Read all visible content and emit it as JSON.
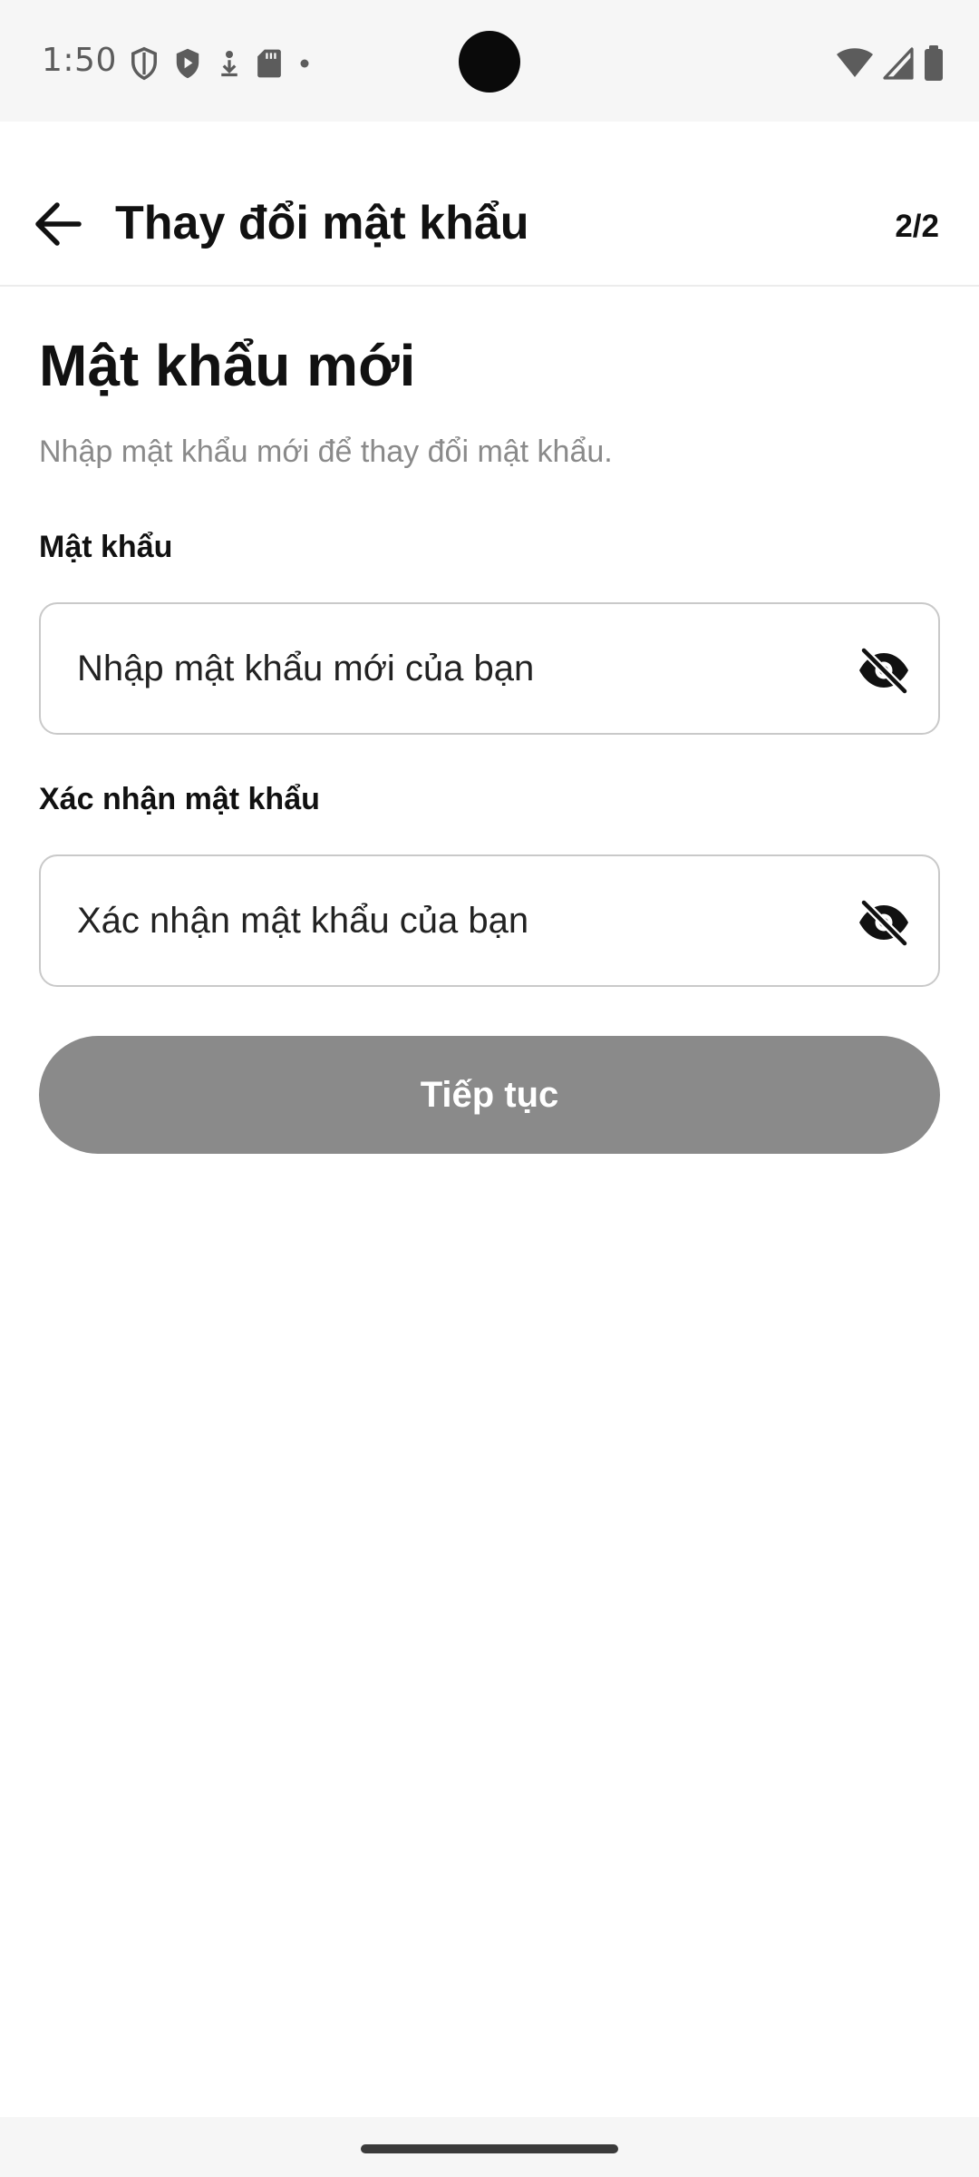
{
  "status_bar": {
    "time": "1:50",
    "left_icons": [
      "shield-outline-icon",
      "shield-play-icon",
      "download-icon",
      "sd-card-icon",
      "dot-icon"
    ],
    "right_icons": [
      "wifi-icon",
      "cellular-signal-icon",
      "battery-icon"
    ]
  },
  "app_bar": {
    "title": "Thay đổi mật khẩu",
    "step": "2/2",
    "back_icon": "arrow-left-icon"
  },
  "main": {
    "heading": "Mật khẩu mới",
    "subtitle": "Nhập mật khẩu mới để thay đổi mật khẩu.",
    "password": {
      "label": "Mật khẩu",
      "value": "",
      "placeholder": "Nhập mật khẩu mới của bạn",
      "toggle_icon": "eye-off-icon"
    },
    "confirm_password": {
      "label": "Xác nhận mật khẩu",
      "value": "",
      "placeholder": "Xác nhận mật khẩu của bạn",
      "toggle_icon": "eye-off-icon"
    },
    "continue_label": "Tiếp tục"
  },
  "colors": {
    "button_disabled": "#8a8a8a",
    "field_border": "#c9c9c9",
    "subtitle_text": "#8a8a8a"
  }
}
